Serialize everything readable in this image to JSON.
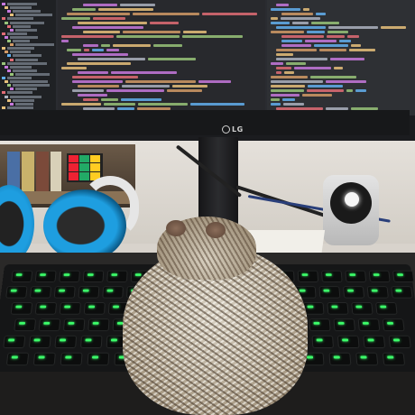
{
  "image": {
    "kind": "photo",
    "monitor_brand": "LG"
  },
  "colors": {
    "keyboard_backlight": "#3cff6a",
    "headphone_accent": "#1e9ee0",
    "screen_background": "#2a2c31"
  }
}
